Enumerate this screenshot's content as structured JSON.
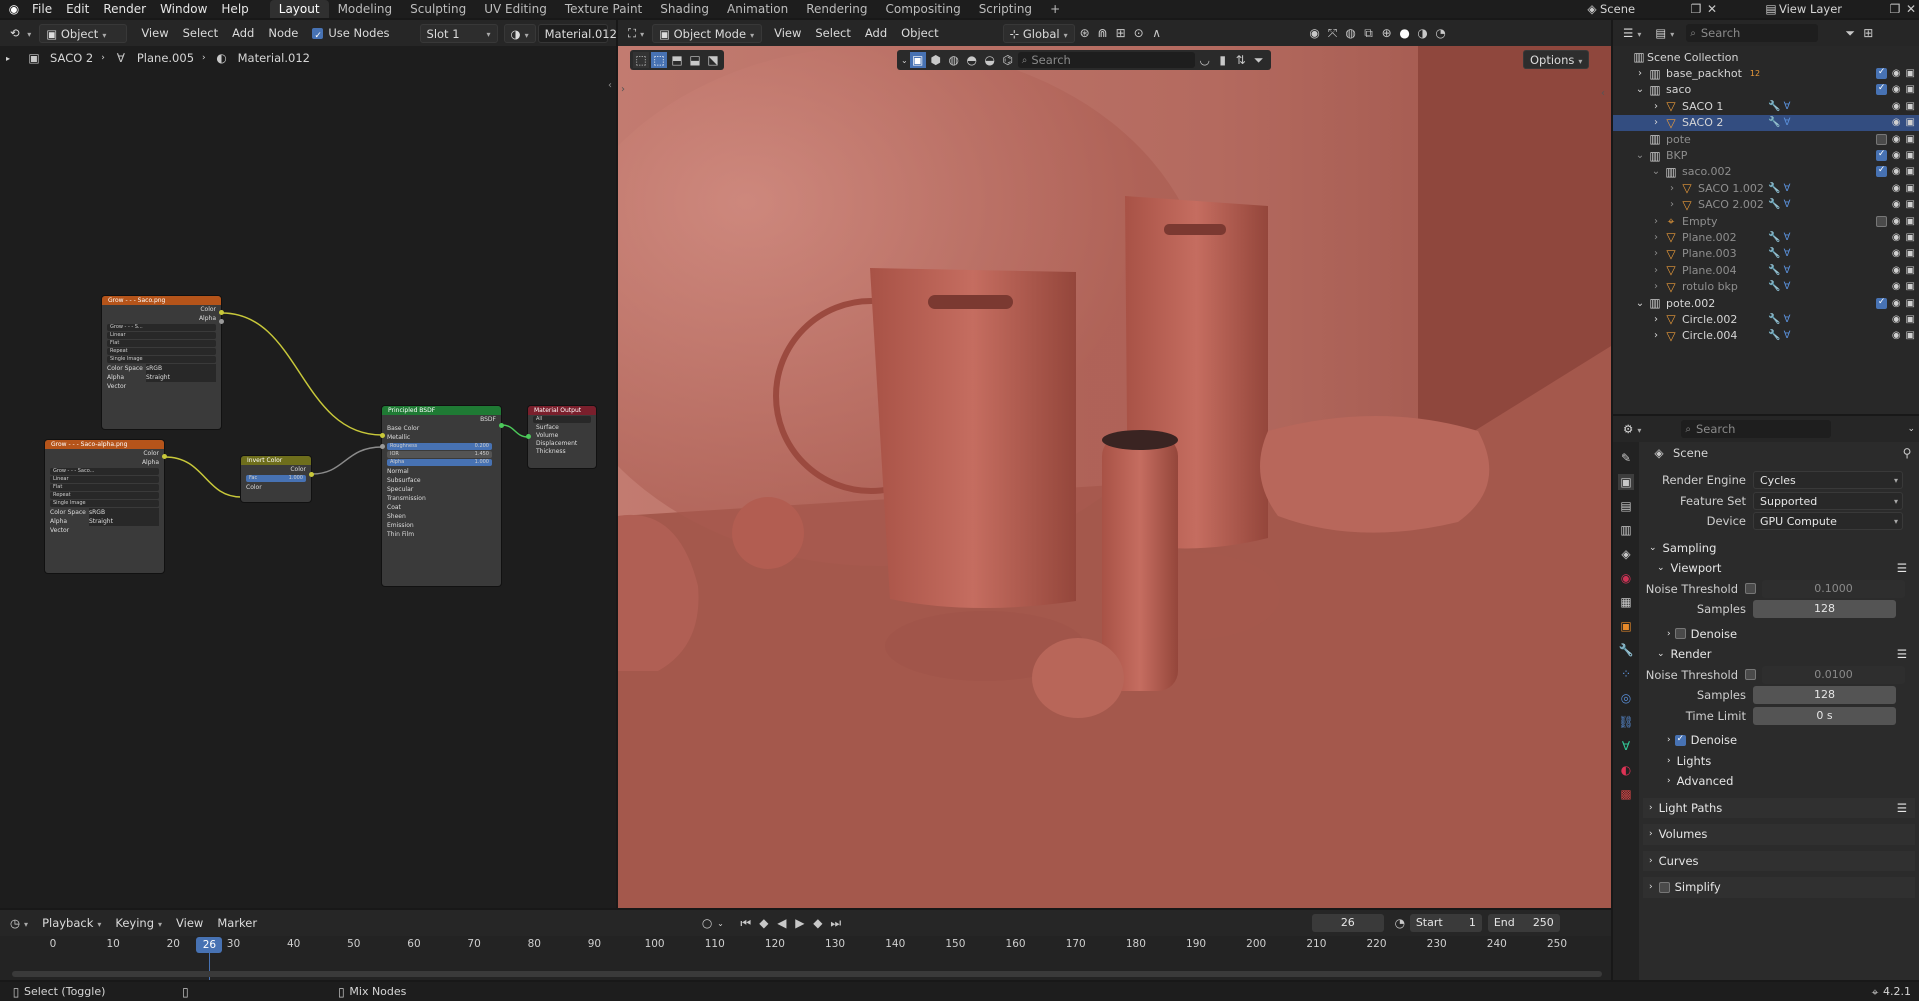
{
  "topbar": {
    "menus": [
      "File",
      "Edit",
      "Render",
      "Window",
      "Help"
    ],
    "workspaces": [
      "Layout",
      "Modeling",
      "Sculpting",
      "UV Editing",
      "Texture Paint",
      "Shading",
      "Animation",
      "Rendering",
      "Compositing",
      "Scripting"
    ],
    "active_workspace": "Layout",
    "add_tab": "+",
    "scene": "Scene",
    "view_layer": "View Layer"
  },
  "node_editor": {
    "object_select": "Object",
    "menus": [
      "View",
      "Select",
      "Add",
      "Node"
    ],
    "use_nodes": "Use Nodes",
    "slot": "Slot 1",
    "material": "Material.012",
    "breadcrumb": [
      "SACO 2",
      "Plane.005",
      "Material.012"
    ],
    "nodes": {
      "tex1": {
        "title": "Grow - - - Saco.png",
        "outputs": [
          "Color",
          "Alpha"
        ],
        "image": "Grow - - - S...",
        "fields": [
          "Linear",
          "Flat",
          "Repeat",
          "Single Image"
        ],
        "color_space_label": "Color Space",
        "color_space": "sRGB",
        "alpha_label": "Alpha",
        "alpha": "Straight",
        "vector": "Vector"
      },
      "tex2": {
        "title": "Grow - - - Saco-alpha.png",
        "outputs": [
          "Color",
          "Alpha"
        ],
        "image": "Grow - - - Saco...",
        "fields": [
          "Linear",
          "Flat",
          "Repeat",
          "Single Image"
        ],
        "color_space_label": "Color Space",
        "color_space": "sRGB",
        "alpha_label": "Alpha",
        "alpha": "Straight",
        "vector": "Vector"
      },
      "invert": {
        "title": "Invert Color",
        "output": "Color",
        "fac_label": "Fac",
        "fac": "1.000",
        "input": "Color"
      },
      "bsdf": {
        "title": "Principled BSDF",
        "output": "BSDF",
        "base_color": "Base Color",
        "metallic": "Metallic",
        "roughness_label": "Roughness",
        "roughness": "0.200",
        "ior_label": "IOR",
        "ior": "1.450",
        "alpha_label": "Alpha",
        "alpha": "1.000",
        "normal": "Normal",
        "sections": [
          "Subsurface",
          "Specular",
          "Transmission",
          "Coat",
          "Sheen",
          "Emission",
          "Thin Film"
        ]
      },
      "output": {
        "title": "Material Output",
        "target": "All",
        "inputs": [
          "Surface",
          "Volume",
          "Displacement",
          "Thickness"
        ]
      }
    }
  },
  "viewport": {
    "mode": "Object Mode",
    "menus": [
      "View",
      "Select",
      "Add",
      "Object"
    ],
    "orientation": "Global",
    "search_placeholder": "Search",
    "options": "Options"
  },
  "outliner": {
    "search_placeholder": "Search",
    "root": "Scene Collection",
    "rows": [
      {
        "label": "base_packhot",
        "indent": 1,
        "expander": "›",
        "icon": "collection",
        "extra": "12",
        "check": true,
        "sel": false,
        "dim": false
      },
      {
        "label": "saco",
        "indent": 1,
        "expander": "⌄",
        "icon": "collection",
        "extra": "",
        "check": true,
        "sel": false,
        "dim": false
      },
      {
        "label": "SACO 1",
        "indent": 2,
        "expander": "›",
        "icon": "mesh",
        "extra": "",
        "check": false,
        "sel": false,
        "dim": false
      },
      {
        "label": "SACO 2",
        "indent": 2,
        "expander": "›",
        "icon": "mesh",
        "extra": "",
        "check": false,
        "sel": true,
        "dim": false
      },
      {
        "label": "pote",
        "indent": 1,
        "expander": "",
        "icon": "collection",
        "extra": "",
        "check": false,
        "sel": false,
        "dim": true
      },
      {
        "label": "BKP",
        "indent": 1,
        "expander": "⌄",
        "icon": "collection",
        "extra": "",
        "check": true,
        "sel": false,
        "dim": true
      },
      {
        "label": "saco.002",
        "indent": 2,
        "expander": "⌄",
        "icon": "collection",
        "extra": "",
        "check": true,
        "sel": false,
        "dim": true
      },
      {
        "label": "SACO 1.002",
        "indent": 3,
        "expander": "›",
        "icon": "mesh",
        "extra": "",
        "check": false,
        "sel": false,
        "dim": true
      },
      {
        "label": "SACO 2.002",
        "indent": 3,
        "expander": "›",
        "icon": "mesh",
        "extra": "",
        "check": false,
        "sel": false,
        "dim": true
      },
      {
        "label": "Empty",
        "indent": 2,
        "expander": "›",
        "icon": "empty",
        "extra": "",
        "check": false,
        "sel": false,
        "dim": true
      },
      {
        "label": "Plane.002",
        "indent": 2,
        "expander": "›",
        "icon": "mesh",
        "extra": "",
        "check": false,
        "sel": false,
        "dim": true
      },
      {
        "label": "Plane.003",
        "indent": 2,
        "expander": "›",
        "icon": "mesh",
        "extra": "",
        "check": false,
        "sel": false,
        "dim": true
      },
      {
        "label": "Plane.004",
        "indent": 2,
        "expander": "›",
        "icon": "mesh",
        "extra": "",
        "check": false,
        "sel": false,
        "dim": true
      },
      {
        "label": "rotulo bkp",
        "indent": 2,
        "expander": "›",
        "icon": "mesh",
        "extra": "",
        "check": false,
        "sel": false,
        "dim": true
      },
      {
        "label": "pote.002",
        "indent": 1,
        "expander": "⌄",
        "icon": "collection",
        "extra": "",
        "check": true,
        "sel": false,
        "dim": false
      },
      {
        "label": "Circle.002",
        "indent": 2,
        "expander": "›",
        "icon": "mesh",
        "extra": "",
        "check": false,
        "sel": false,
        "dim": false
      },
      {
        "label": "Circle.004",
        "indent": 2,
        "expander": "›",
        "icon": "mesh",
        "extra": "",
        "check": false,
        "sel": false,
        "dim": false
      }
    ]
  },
  "properties": {
    "search_placeholder": "Search",
    "context": "Scene",
    "render_engine_label": "Render Engine",
    "render_engine": "Cycles",
    "feature_set_label": "Feature Set",
    "feature_set": "Supported",
    "device_label": "Device",
    "device": "GPU Compute",
    "sampling": "Sampling",
    "viewport": "Viewport",
    "vp_noise_label": "Noise Threshold",
    "vp_noise": "0.1000",
    "vp_samples_label": "Samples",
    "vp_samples": "128",
    "vp_denoise": "Denoise",
    "render": "Render",
    "r_noise_label": "Noise Threshold",
    "r_noise": "0.0100",
    "r_samples_label": "Samples",
    "r_samples": "128",
    "r_time_label": "Time Limit",
    "r_time": "0 s",
    "r_denoise": "Denoise",
    "lights": "Lights",
    "advanced": "Advanced",
    "light_paths": "Light Paths",
    "volumes": "Volumes",
    "curves": "Curves",
    "simplify": "Simplify"
  },
  "timeline": {
    "menus": [
      "Playback",
      "Keying",
      "View",
      "Marker"
    ],
    "current_frame": "26",
    "start_label": "Start",
    "start": "1",
    "end_label": "End",
    "end": "250",
    "ticks": [
      "0",
      "10",
      "20",
      "30",
      "40",
      "50",
      "60",
      "70",
      "80",
      "90",
      "100",
      "110",
      "120",
      "130",
      "140",
      "150",
      "160",
      "170",
      "180",
      "190",
      "200",
      "210",
      "220",
      "230",
      "240",
      "250"
    ],
    "playhead_value": 26,
    "frame_max": 250
  },
  "statusbar": {
    "left": "Select (Toggle)",
    "middle": "Mix Nodes",
    "version": "4.2.1"
  }
}
